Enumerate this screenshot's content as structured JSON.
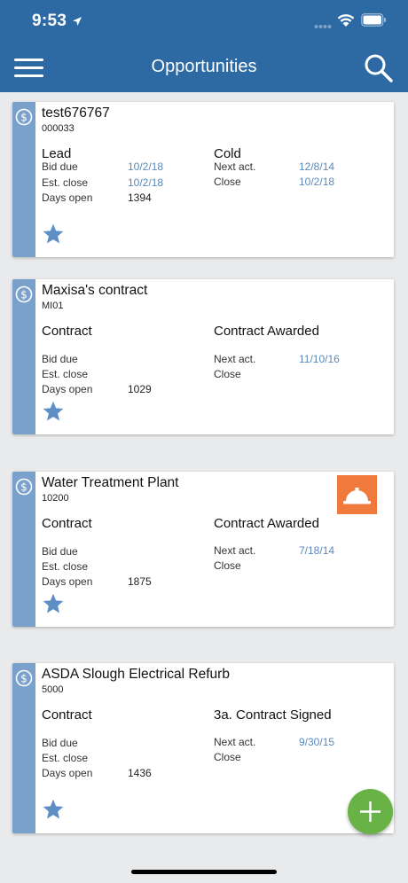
{
  "status": {
    "time": "9:53"
  },
  "header": {
    "title": "Opportunities"
  },
  "labels": {
    "bid_due": "Bid due",
    "est_close": "Est. close",
    "days_open": "Days open",
    "next_act": "Next act.",
    "close": "Close"
  },
  "cards": [
    {
      "name": "test676767",
      "code": "000033",
      "type": "Lead",
      "stage": "Cold",
      "bid_due": "10/2/18",
      "est_close": "10/2/18",
      "days_open": "1394",
      "next_act": "12/8/14",
      "close": "10/2/18"
    },
    {
      "name": "Maxisa's contract",
      "code": "MI01",
      "type": "Contract",
      "stage": "Contract Awarded",
      "bid_due": "",
      "est_close": "",
      "days_open": "1029",
      "next_act": "11/10/16",
      "close": ""
    },
    {
      "name": "Water Treatment Plant",
      "code": "10200",
      "type": "Contract",
      "stage": "Contract Awarded",
      "bid_due": "",
      "est_close": "",
      "days_open": "1875",
      "next_act": "7/18/14",
      "close": ""
    },
    {
      "name": "ASDA Slough Electrical Refurb",
      "code": "5000",
      "type": "Contract",
      "stage": "3a. Contract Signed",
      "bid_due": "",
      "est_close": "",
      "days_open": "1436",
      "next_act": "9/30/15",
      "close": ""
    }
  ],
  "icons": {
    "menu": "hamburger-menu-icon",
    "search": "search-icon",
    "opportunity": "dollar-circle-icon",
    "favorite": "star-icon",
    "construction": "hard-hat-icon",
    "add": "plus-icon"
  },
  "colors": {
    "header": "#2d69a3",
    "stripe": "#79a1cb",
    "star": "#5d8fc6",
    "fab": "#69b246",
    "badge": "#f07a3c",
    "date": "#5b89b8"
  }
}
